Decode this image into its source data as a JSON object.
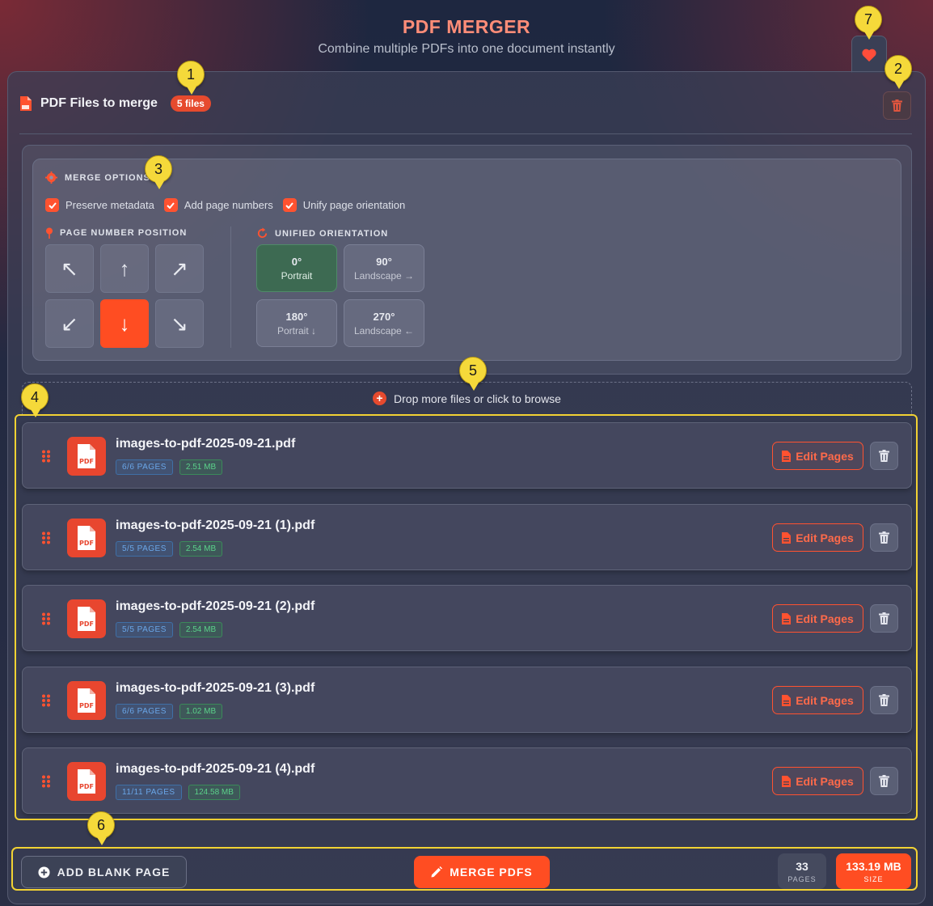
{
  "header": {
    "title": "PDF MERGER",
    "subtitle": "Combine multiple PDFs into one document instantly"
  },
  "files_section": {
    "title": "PDF Files to merge",
    "count_badge": "5 files"
  },
  "merge_options": {
    "title": "MERGE OPTIONS",
    "checkboxes": [
      {
        "label": "Preserve metadata",
        "checked": true
      },
      {
        "label": "Add page numbers",
        "checked": true
      },
      {
        "label": "Unify page orientation",
        "checked": true
      }
    ],
    "page_number_position": {
      "title": "PAGE NUMBER POSITION",
      "arrows": [
        "↖",
        "↑",
        "↗",
        "↙",
        "↓",
        "↘"
      ],
      "selected": "↓"
    },
    "unified_orientation": {
      "title": "UNIFIED ORIENTATION",
      "options": [
        {
          "deg": "0°",
          "label": "Portrait",
          "active": true
        },
        {
          "deg": "90°",
          "label": "Landscape →",
          "active": false
        },
        {
          "deg": "180°",
          "label": "Portrait ↓",
          "active": false
        },
        {
          "deg": "270°",
          "label": "Landscape ←",
          "active": false
        }
      ]
    }
  },
  "dropzone": {
    "label": "Drop more files or click to browse"
  },
  "files": [
    {
      "name": "images-to-pdf-2025-09-21.pdf",
      "pages": "6/6 PAGES",
      "size": "2.51 MB",
      "edit_label": "Edit Pages"
    },
    {
      "name": "images-to-pdf-2025-09-21 (1).pdf",
      "pages": "5/5 PAGES",
      "size": "2.54 MB",
      "edit_label": "Edit Pages"
    },
    {
      "name": "images-to-pdf-2025-09-21 (2).pdf",
      "pages": "5/5 PAGES",
      "size": "2.54 MB",
      "edit_label": "Edit Pages"
    },
    {
      "name": "images-to-pdf-2025-09-21 (3).pdf",
      "pages": "6/6 PAGES",
      "size": "1.02 MB",
      "edit_label": "Edit Pages"
    },
    {
      "name": "images-to-pdf-2025-09-21 (4).pdf",
      "pages": "11/11 PAGES",
      "size": "124.58 MB",
      "edit_label": "Edit Pages"
    }
  ],
  "footer": {
    "add_blank_label": "ADD BLANK PAGE",
    "merge_label": "MERGE PDFS",
    "pages_value": "33",
    "pages_label": "PAGES",
    "size_value": "133.19 MB",
    "size_label": "SIZE"
  },
  "markers": [
    "1",
    "2",
    "3",
    "4",
    "5",
    "6",
    "7"
  ],
  "colors": {
    "accent": "#ff4d22",
    "title": "#ff8d78",
    "highlight": "#f2d233",
    "active_orientation": "#3d6a52"
  }
}
